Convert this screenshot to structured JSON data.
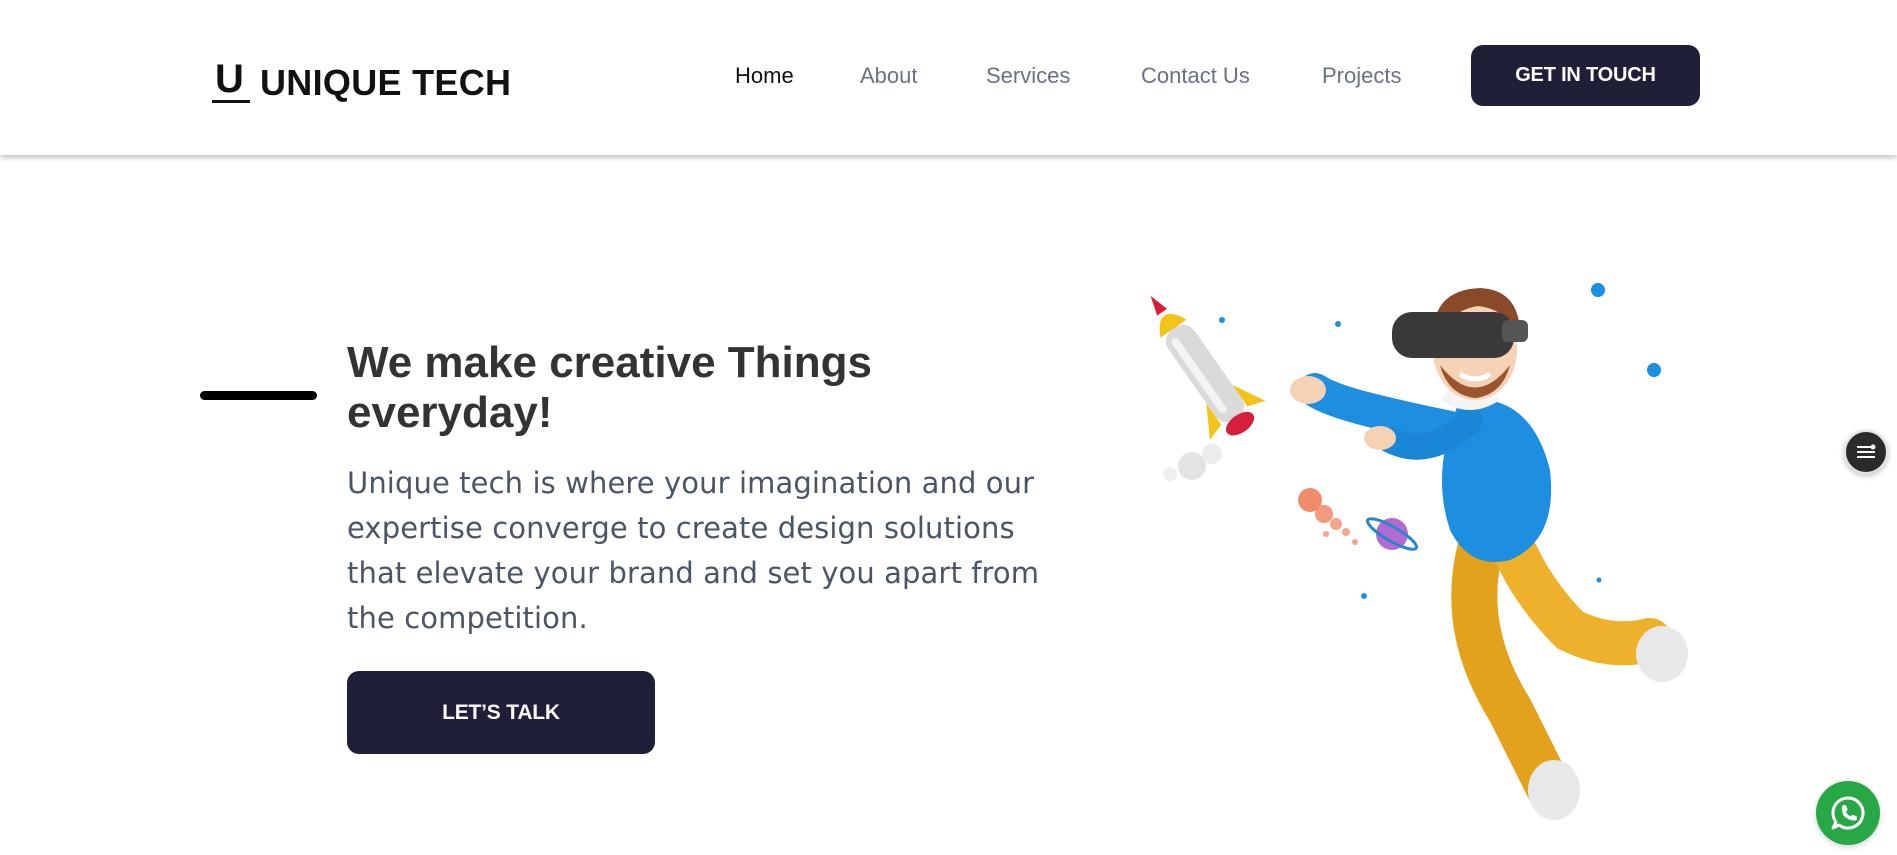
{
  "header": {
    "logo": {
      "mark": "U",
      "text": "UNIQUE TECH"
    },
    "nav": [
      {
        "label": "Home",
        "active": true
      },
      {
        "label": "About",
        "active": false
      },
      {
        "label": "Services",
        "active": false
      },
      {
        "label": "Contact Us",
        "active": false
      },
      {
        "label": "Projects",
        "active": false
      }
    ],
    "cta_label": "GET IN TOUCH"
  },
  "hero": {
    "title": "We make creative Things everyday!",
    "description": "Unique tech is where your imagination and our expertise converge to create design solutions that elevate your brand and set you apart from the competition.",
    "cta_label": "LET’S TALK",
    "illustration_icon": "vr-man-with-rocket-illustration"
  },
  "widgets": {
    "side_icon": "settings-sliders-icon",
    "chat_icon": "whatsapp-icon"
  },
  "colors": {
    "primary_dark": "#1f1f38",
    "text_dark": "#333333",
    "text_body": "#4b5563",
    "nav_inactive": "#6b7280",
    "whatsapp_green": "#27a745"
  }
}
